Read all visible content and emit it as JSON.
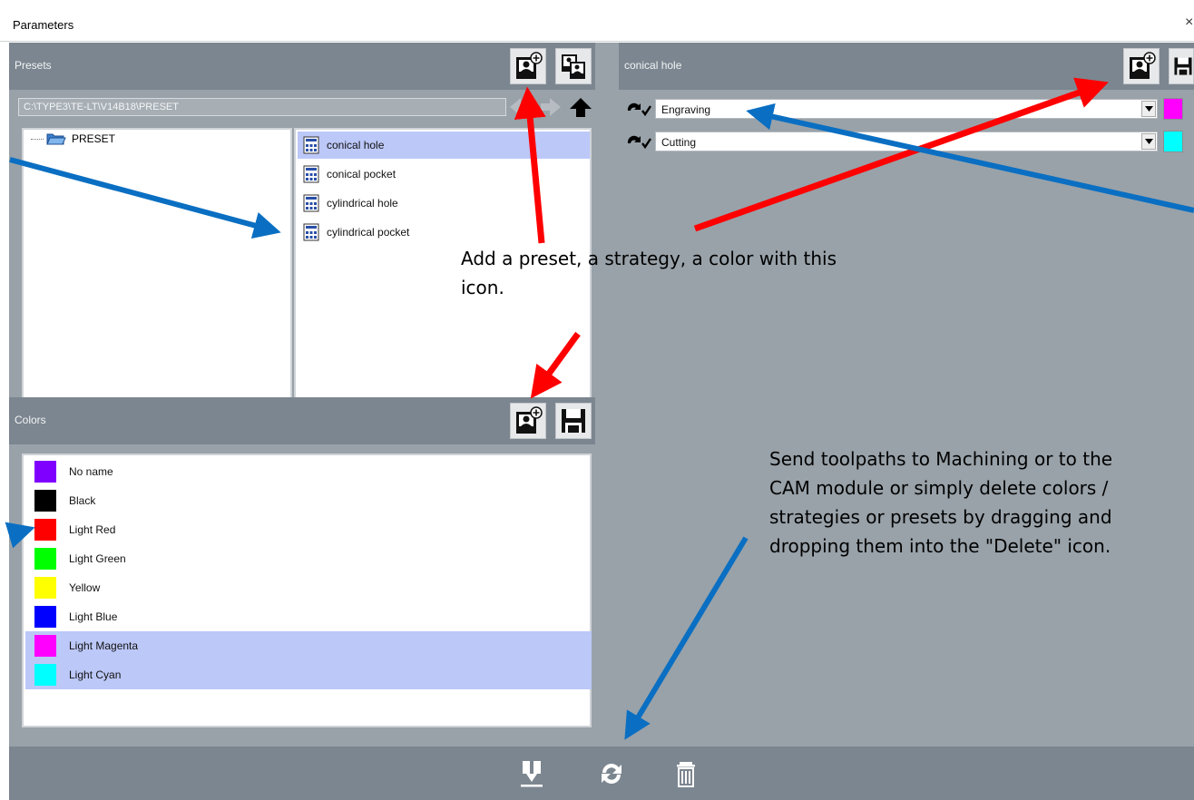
{
  "window": {
    "title": "Parameters",
    "close": "×"
  },
  "presets": {
    "header": "Presets",
    "path": "C:\\TYPE3\\TE-LT\\V14B18\\PRESET",
    "tree_root": "PRESET",
    "items": [
      {
        "label": "conical hole",
        "selected": true
      },
      {
        "label": "conical pocket",
        "selected": false
      },
      {
        "label": "cylindrical hole",
        "selected": false
      },
      {
        "label": "cylindrical pocket",
        "selected": false
      }
    ]
  },
  "colors": {
    "header": "Colors",
    "items": [
      {
        "label": "No name",
        "color": "#8000ff",
        "selected": false
      },
      {
        "label": "Black",
        "color": "#000000",
        "selected": false
      },
      {
        "label": "Light Red",
        "color": "#ff0000",
        "selected": false
      },
      {
        "label": "Light Green",
        "color": "#00ff00",
        "selected": false
      },
      {
        "label": "Yellow",
        "color": "#ffff00",
        "selected": false
      },
      {
        "label": "Light Blue",
        "color": "#0000ff",
        "selected": false
      },
      {
        "label": "Light Magenta",
        "color": "#ff00ff",
        "selected": true
      },
      {
        "label": "Light Cyan",
        "color": "#00ffff",
        "selected": true
      }
    ]
  },
  "strategy": {
    "header": "conical hole",
    "rows": [
      {
        "value": "Engraving",
        "color": "#ff00ff"
      },
      {
        "value": "Cutting",
        "color": "#00ffff"
      }
    ]
  },
  "callouts": {
    "add_icon": "Add a preset, a strategy, a color with this icon.",
    "send_delete": "Send toolpaths to Machining or to the CAM module or simply delete colors / strategies or presets by dragging and dropping them into the \"Delete\" icon."
  },
  "icons": {
    "add": "add-preset-icon",
    "copy": "copy-preset-icon",
    "save": "save-icon",
    "send": "send-to-machining-icon",
    "refresh": "refresh-icon",
    "delete": "delete-trash-icon"
  }
}
